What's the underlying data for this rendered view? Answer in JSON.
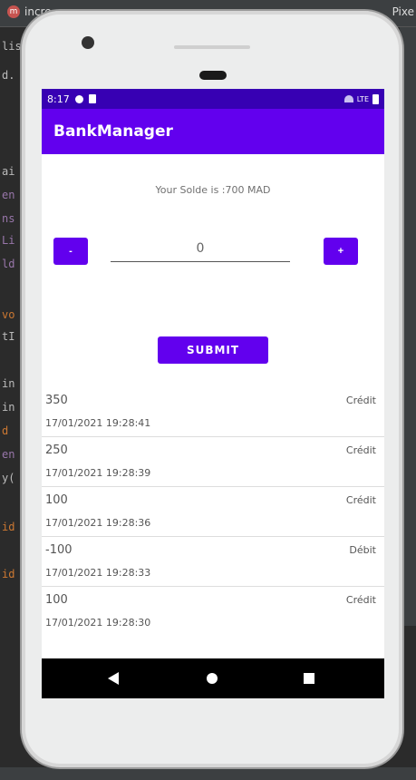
{
  "ide": {
    "tab_left": "incre",
    "tab_right": "Pixe",
    "code_fragments": [
      "list",
      "d.",
      "ai",
      "en",
      "ns",
      "Li",
      "ld",
      "vo",
      "tI",
      "in",
      "in",
      "d",
      "en",
      "y(",
      "id",
      "id"
    ]
  },
  "status_bar": {
    "time": "8:17",
    "network": "LTE"
  },
  "app": {
    "title": "BankManager"
  },
  "balance": {
    "text": "Your Solde is :700 MAD"
  },
  "stepper": {
    "minus_label": "-",
    "plus_label": "+",
    "value": "0"
  },
  "submit": {
    "label": "SUBMIT"
  },
  "transactions": [
    {
      "amount": "350",
      "date": "17/01/2021 19:28:41",
      "type": "Crédit"
    },
    {
      "amount": "250",
      "date": "17/01/2021 19:28:39",
      "type": "Crédit"
    },
    {
      "amount": "100",
      "date": "17/01/2021 19:28:36",
      "type": "Crédit"
    },
    {
      "amount": "-100",
      "date": "17/01/2021 19:28:33",
      "type": "Débit"
    },
    {
      "amount": "100",
      "date": "17/01/2021 19:28:30",
      "type": "Crédit"
    }
  ],
  "colors": {
    "primary": "#6200ee",
    "primary_dark": "#3700b3",
    "navbar": "#000000"
  }
}
